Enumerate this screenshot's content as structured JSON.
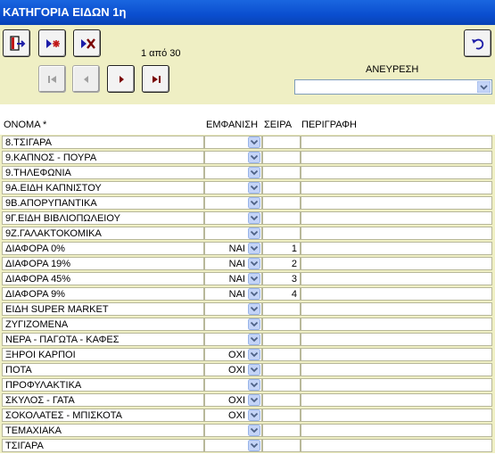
{
  "window": {
    "title": "ΚΑΤΗΓΟΡΙΑ ΕΙΔΩΝ 1η"
  },
  "toolbar": {
    "record_counter": "1 από 30",
    "search_label": "ΑΝΕΥΡΕΣΗ",
    "search_value": ""
  },
  "columns": {
    "name": "ΟΝΟΜΑ *",
    "show": "ΕΜΦΑΝΙΣΗ",
    "order": "ΣΕΙΡΑ",
    "description": "ΠΕΡΙΓΡΑΦΗ"
  },
  "rows": [
    {
      "name": "8.ΤΣΙΓΑΡΑ",
      "show": "",
      "order": "",
      "description": ""
    },
    {
      "name": "9.ΚΑΠΝΟΣ - ΠΟΥΡΑ",
      "show": "",
      "order": "",
      "description": ""
    },
    {
      "name": "9.ΤΗΛΕΦΩΝΙΑ",
      "show": "",
      "order": "",
      "description": ""
    },
    {
      "name": "9Α.ΕΙΔΗ ΚΑΠΝΙΣΤΟΥ",
      "show": "",
      "order": "",
      "description": ""
    },
    {
      "name": "9Β.ΑΠΟΡΥΠΑΝΤΙΚΑ",
      "show": "",
      "order": "",
      "description": ""
    },
    {
      "name": "9Γ.ΕΙΔΗ ΒΙΒΛΙΟΠΩΛΕΙΟΥ",
      "show": "",
      "order": "",
      "description": ""
    },
    {
      "name": "9Ζ.ΓΑΛΑΚΤΟΚΟΜΙΚΑ",
      "show": "",
      "order": "",
      "description": ""
    },
    {
      "name": "ΔΙΑΦΟΡΑ 0%",
      "show": "ΝΑΙ",
      "order": "1",
      "description": ""
    },
    {
      "name": "ΔΙΑΦΟΡΑ 19%",
      "show": "ΝΑΙ",
      "order": "2",
      "description": ""
    },
    {
      "name": "ΔΙΑΦΟΡΑ 45%",
      "show": "ΝΑΙ",
      "order": "3",
      "description": ""
    },
    {
      "name": "ΔΙΑΦΟΡΑ 9%",
      "show": "ΝΑΙ",
      "order": "4",
      "description": ""
    },
    {
      "name": "ΕΙΔΗ SUPER MARKET",
      "show": "",
      "order": "",
      "description": ""
    },
    {
      "name": "ΖΥΓΙΖΟΜΕΝΑ",
      "show": "",
      "order": "",
      "description": ""
    },
    {
      "name": "ΝΕΡΑ - ΠΑΓΩΤΑ - ΚΑΦΕΣ",
      "show": "",
      "order": "",
      "description": ""
    },
    {
      "name": "ΞΗΡΟΙ ΚΑΡΠΟΙ",
      "show": "ΟΧΙ",
      "order": "",
      "description": ""
    },
    {
      "name": "ΠΟΤΑ",
      "show": "ΟΧΙ",
      "order": "",
      "description": ""
    },
    {
      "name": "ΠΡΟΦΥΛΑΚΤΙΚΑ",
      "show": "",
      "order": "",
      "description": ""
    },
    {
      "name": "ΣΚΥΛΟΣ - ΓΑΤΑ",
      "show": "ΟΧΙ",
      "order": "",
      "description": ""
    },
    {
      "name": "ΣΟΚΟΛΑΤΕΣ - ΜΠΙΣΚΟΤΑ",
      "show": "ΟΧΙ",
      "order": "",
      "description": ""
    },
    {
      "name": "ΤΕΜΑΧΙΑΚΑ",
      "show": "",
      "order": "",
      "description": ""
    },
    {
      "name": "ΤΣΙΓΑΡΑ",
      "show": "",
      "order": "",
      "description": ""
    }
  ],
  "icons": {
    "exit": "exit-door-icon",
    "new": "new-record-icon",
    "delete": "delete-record-icon",
    "undo": "undo-icon",
    "first": "first-record-icon",
    "prev": "previous-record-icon",
    "next": "next-record-icon",
    "last": "last-record-icon"
  },
  "colors": {
    "titlebar": "#0a4ecf",
    "toolbar_bg": "#efefc4",
    "icon_blue": "#1c1ca8",
    "icon_red": "#c01818",
    "icon_dark_red": "#7a0000"
  }
}
